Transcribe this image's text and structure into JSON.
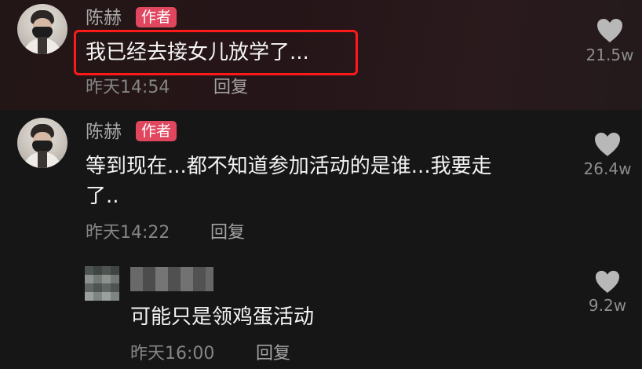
{
  "comments": [
    {
      "author": "陈赫",
      "badge": "作者",
      "text": "我已经去接女儿放学了...",
      "time": "昨天14:54",
      "reply": "回复",
      "likes": "21.5w"
    },
    {
      "author": "陈赫",
      "badge": "作者",
      "text_line1": "等到现在...都不知道参加活动的是谁...我要走",
      "text_line2": "了..",
      "time": "昨天14:22",
      "reply": "回复",
      "likes": "26.4w"
    },
    {
      "text": "可能只是领鸡蛋活动",
      "time": "昨天16:00",
      "reply": "回复",
      "likes": "9.2w"
    }
  ],
  "colors": {
    "badge": "#e0475f",
    "highlight": "#ff1a1a",
    "background_top": "#231616",
    "background": "#161616"
  },
  "icons": {
    "like": "heart-icon"
  }
}
